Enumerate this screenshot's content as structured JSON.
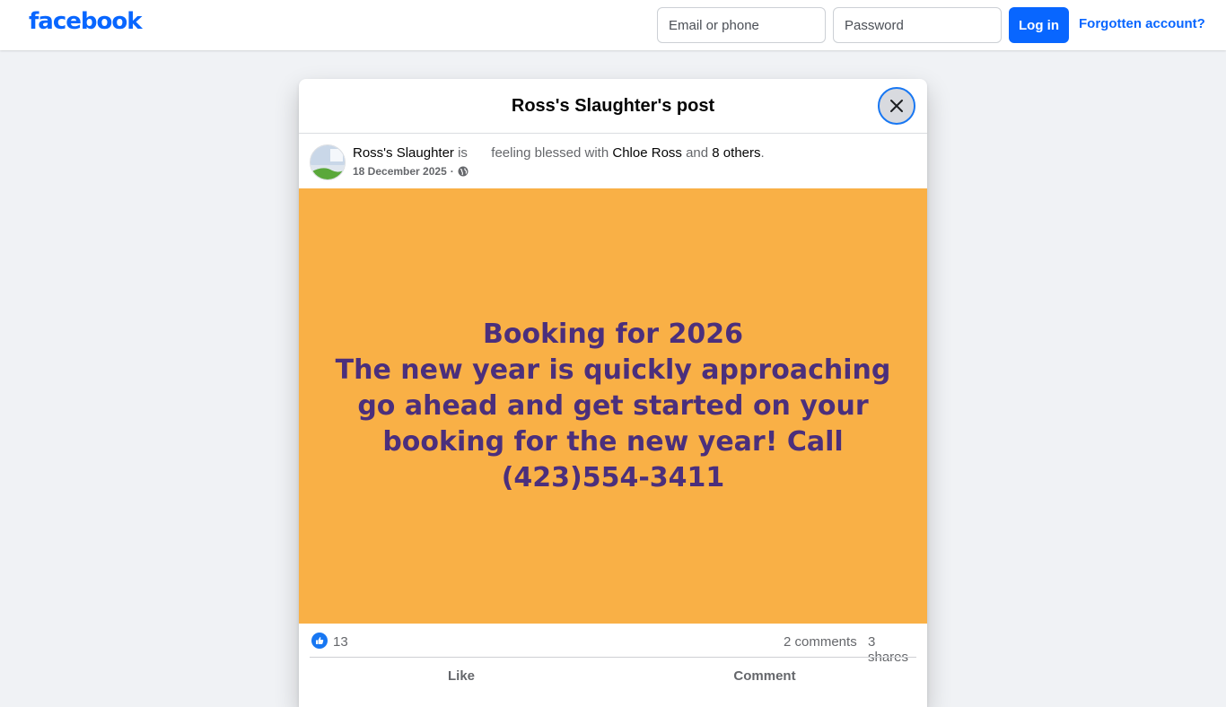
{
  "topbar": {
    "logo": "facebook",
    "email_placeholder": "Email or phone",
    "password_placeholder": "Password",
    "login_label": "Log in",
    "forgot_label": "Forgotten account?"
  },
  "modal": {
    "title": "Ross's Slaughter's post"
  },
  "post": {
    "author": "Ross's Slaughter",
    "is_text": "is",
    "feeling_text": "feeling blessed with",
    "tagged": "Chloe Ross",
    "and_text": "and",
    "others": "8 others",
    "period": ".",
    "date": "18 December 2025",
    "date_sep": "·",
    "body_lines": [
      "Booking for 2026",
      "The new year is quickly approaching go ahead and get started on your booking for the new year! Call (423)554-3411"
    ],
    "background_color": "#f9b046",
    "text_color": "#4b2f7c"
  },
  "stats": {
    "likes": "13",
    "comments": "2 comments",
    "shares": "3 shares"
  },
  "actions": {
    "like": "Like",
    "comment": "Comment"
  },
  "colors": {
    "brand": "#0866ff",
    "page_bg": "#f0f2f5"
  }
}
